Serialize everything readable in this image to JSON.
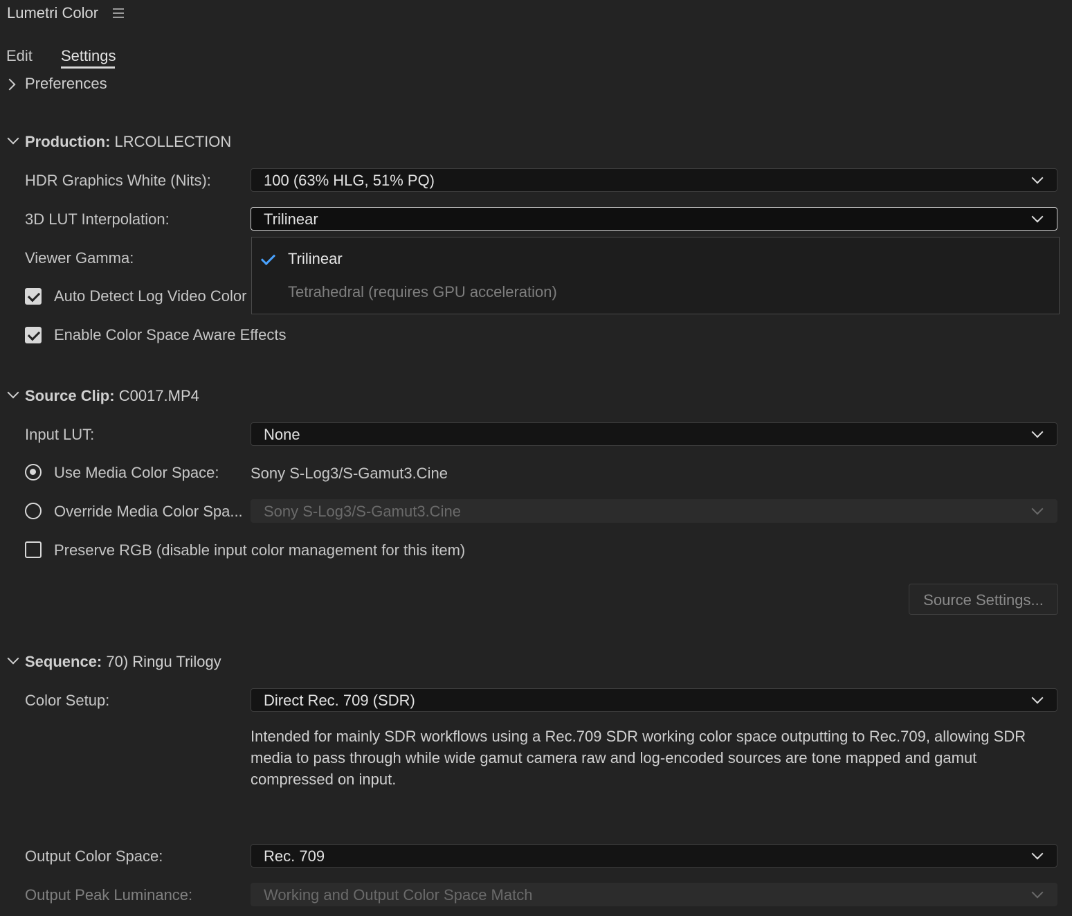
{
  "panel": {
    "title": "Lumetri Color",
    "menu_icon": "hamburger-menu-icon"
  },
  "tabs": [
    {
      "label": "Edit",
      "active": false
    },
    {
      "label": "Settings",
      "active": true
    }
  ],
  "preferences": {
    "label": "Preferences",
    "expanded": false
  },
  "production": {
    "heading_bold": "Production:",
    "heading_value": " LRCOLLECTION",
    "hdr_white": {
      "label": "HDR Graphics White (Nits):",
      "value": "100 (63% HLG, 51% PQ)"
    },
    "lut_interp": {
      "label": "3D LUT Interpolation:",
      "value": "Trilinear"
    },
    "viewer_gamma": {
      "label": "Viewer Gamma:"
    },
    "auto_detect": {
      "label": "Auto Detect Log Video Color Space",
      "checked": true
    },
    "color_aware": {
      "label": "Enable Color Space Aware Effects",
      "checked": true
    }
  },
  "lut_menu": {
    "options": [
      {
        "label": "Trilinear",
        "selected": true
      },
      {
        "label": "Tetrahedral (requires GPU acceleration)",
        "selected": false,
        "disabled": true
      }
    ]
  },
  "source_clip": {
    "heading_bold": "Source Clip:",
    "heading_value": " C0017.MP4",
    "input_lut": {
      "label": "Input LUT:",
      "value": "None"
    },
    "use_media": {
      "label": "Use Media Color Space:",
      "value": "Sony S-Log3/S-Gamut3.Cine",
      "selected": true
    },
    "override_media": {
      "label": "Override Media Color Spa...",
      "value": "Sony S-Log3/S-Gamut3.Cine",
      "selected": false
    },
    "preserve_rgb": {
      "label": "Preserve RGB (disable input color management for this item)",
      "checked": false
    },
    "source_settings_button": "Source Settings..."
  },
  "sequence": {
    "heading_bold": "Sequence:",
    "heading_value": " 70) Ringu Trilogy",
    "color_setup": {
      "label": "Color Setup:",
      "value": "Direct Rec. 709 (SDR)"
    },
    "description": "Intended for mainly SDR workflows using a Rec.709 SDR working color space outputting to Rec.709, allowing SDR media to pass through while wide gamut camera raw and log-encoded sources are tone mapped and gamut compressed on input.",
    "output_space": {
      "label": "Output Color Space:",
      "value": "Rec. 709"
    },
    "output_peak": {
      "label": "Output Peak Luminance:",
      "value": "Working and Output Color Space Match"
    }
  },
  "colors": {
    "background": "#232323",
    "accent_check": "#4aa3ff"
  }
}
